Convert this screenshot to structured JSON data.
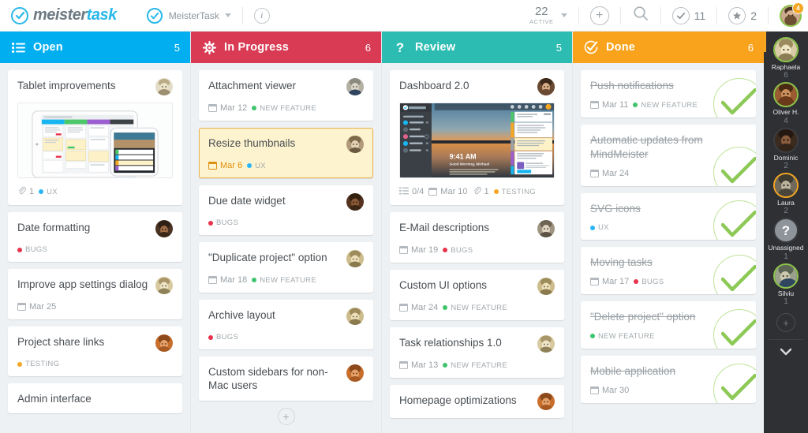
{
  "app": {
    "brand_meister": "meister",
    "brand_task": "task",
    "project_name": "MeisterTask",
    "info_icon": "info-icon",
    "logo_check_icon": "check-circle-icon",
    "project_check_icon": "check-circle-icon",
    "project_caret_icon": "chevron-down-icon"
  },
  "toolbar": {
    "active_count": "22",
    "active_label": "ACTIVE",
    "active_caret_icon": "chevron-down-icon",
    "add_icon": "plus-circle-icon",
    "search_icon": "search-icon",
    "tasks_icon": "check-circle-icon",
    "tasks_count": "11",
    "starred_icon": "star-circle-icon",
    "starred_count": "2",
    "avatar_icon": "user-avatar",
    "avatar_badge": "4",
    "colors": {
      "brand": "#2ab8e8",
      "badge": "#f5a623",
      "avatar_ring": "#8bc34a"
    }
  },
  "columns": [
    {
      "id": "open",
      "title": "Open",
      "count": "5",
      "color": "#01aff0",
      "icon": "list-icon",
      "cards": [
        {
          "title": "Tablet improvements",
          "avatar": "user-avatar",
          "image": "tablet-mockup-thumbnail",
          "meta": [
            {
              "type": "attachment",
              "icon": "paperclip-icon",
              "text": "1"
            },
            {
              "type": "tag",
              "text": "UX",
              "color": "#29b6f6"
            }
          ]
        },
        {
          "title": "Date formatting",
          "avatar": "user-avatar",
          "meta": [
            {
              "type": "tag",
              "text": "BUGS",
              "color": "#e8324b"
            }
          ]
        },
        {
          "title": "Improve app settings dialog",
          "avatar": "user-avatar",
          "meta": [
            {
              "type": "date",
              "icon": "calendar-icon",
              "text": "Mar 25"
            }
          ]
        },
        {
          "title": "Project share links",
          "avatar": "user-avatar",
          "meta": [
            {
              "type": "tag",
              "text": "TESTING",
              "color": "#f5a623"
            }
          ]
        },
        {
          "title": "Admin interface",
          "meta": []
        }
      ]
    },
    {
      "id": "in-progress",
      "title": "In Progress",
      "count": "6",
      "color": "#d93b54",
      "icon": "gear-icon",
      "cards": [
        {
          "title": "Attachment viewer",
          "avatar": "user-avatar",
          "meta": [
            {
              "type": "date",
              "icon": "calendar-icon",
              "text": "Mar 12"
            },
            {
              "type": "tag",
              "text": "NEW FEATURE",
              "color": "#3ec46d"
            }
          ]
        },
        {
          "title": "Resize thumbnails",
          "avatar": "user-avatar",
          "highlight": true,
          "meta": [
            {
              "type": "date",
              "icon": "calendar-icon",
              "text": "Mar 6"
            },
            {
              "type": "tag",
              "text": "UX",
              "color": "#29b6f6"
            }
          ]
        },
        {
          "title": "Due date widget",
          "avatar": "user-avatar",
          "meta": [
            {
              "type": "tag",
              "text": "BUGS",
              "color": "#e8324b"
            }
          ]
        },
        {
          "title": "\"Duplicate project\" option",
          "avatar": "user-avatar",
          "meta": [
            {
              "type": "date",
              "icon": "calendar-icon",
              "text": "Mar 18"
            },
            {
              "type": "tag",
              "text": "NEW FEATURE",
              "color": "#3ec46d"
            }
          ]
        },
        {
          "title": "Archive layout",
          "avatar": "user-avatar",
          "meta": [
            {
              "type": "tag",
              "text": "BUGS",
              "color": "#e8324b"
            }
          ]
        },
        {
          "title": "Custom sidebars for non-Mac users",
          "avatar": "user-avatar",
          "meta": []
        }
      ],
      "add_card_icon": "plus-icon"
    },
    {
      "id": "review",
      "title": "Review",
      "count": "5",
      "color": "#2cbcb2",
      "icon": "question-mark-icon",
      "cards": [
        {
          "title": "Dashboard 2.0",
          "avatar": "user-avatar",
          "image": "dashboard-screenshot-thumbnail",
          "meta": [
            {
              "type": "checklist",
              "icon": "checklist-icon",
              "text": "0/4"
            },
            {
              "type": "date",
              "icon": "calendar-icon",
              "text": "Mar 10"
            },
            {
              "type": "attachment",
              "icon": "paperclip-icon",
              "text": "1"
            },
            {
              "type": "tag",
              "text": "TESTING",
              "color": "#f5a623"
            }
          ]
        },
        {
          "title": "E-Mail descriptions",
          "avatar": "user-avatar",
          "meta": [
            {
              "type": "date",
              "icon": "calendar-icon",
              "text": "Mar 19"
            },
            {
              "type": "tag",
              "text": "BUGS",
              "color": "#e8324b"
            }
          ]
        },
        {
          "title": "Custom UI options",
          "avatar": "user-avatar",
          "meta": [
            {
              "type": "date",
              "icon": "calendar-icon",
              "text": "Mar 24"
            },
            {
              "type": "tag",
              "text": "NEW FEATURE",
              "color": "#3ec46d"
            }
          ]
        },
        {
          "title": "Task relationships 1.0",
          "avatar": "user-avatar",
          "meta": [
            {
              "type": "date",
              "icon": "calendar-icon",
              "text": "Mar 13"
            },
            {
              "type": "tag",
              "text": "NEW FEATURE",
              "color": "#3ec46d"
            }
          ]
        },
        {
          "title": "Homepage optimizations",
          "avatar": "user-avatar",
          "meta": []
        }
      ]
    },
    {
      "id": "done",
      "title": "Done",
      "count": "6",
      "color": "#f9a21b",
      "icon": "check-circle-icon",
      "done": true,
      "cards": [
        {
          "title": "Push notifications",
          "done": true,
          "check_icon": "check-icon",
          "meta": [
            {
              "type": "date",
              "icon": "calendar-icon",
              "text": "Mar 11"
            },
            {
              "type": "tag",
              "text": "NEW FEATURE",
              "color": "#3ec46d"
            }
          ]
        },
        {
          "title": "Automatic updates from MindMeister",
          "done": true,
          "check_icon": "check-icon",
          "meta": [
            {
              "type": "date",
              "icon": "calendar-icon",
              "text": "Mar 24"
            }
          ]
        },
        {
          "title": "SVG icons",
          "done": true,
          "check_icon": "check-icon",
          "meta": [
            {
              "type": "tag",
              "text": "UX",
              "color": "#29b6f6"
            }
          ]
        },
        {
          "title": "Moving tasks",
          "done": true,
          "check_icon": "check-icon",
          "meta": [
            {
              "type": "date",
              "icon": "calendar-icon",
              "text": "Mar 17"
            },
            {
              "type": "tag",
              "text": "BUGS",
              "color": "#e8324b"
            }
          ]
        },
        {
          "title": "\"Delete project\" option",
          "done": true,
          "check_icon": "check-icon",
          "meta": [
            {
              "type": "tag",
              "text": "NEW FEATURE",
              "color": "#3ec46d"
            }
          ]
        },
        {
          "title": "Mobile application",
          "done": true,
          "check_icon": "check-icon",
          "meta": [
            {
              "type": "date",
              "icon": "calendar-icon",
              "text": "Mar 30"
            }
          ]
        }
      ]
    }
  ],
  "sidebar": {
    "members": [
      {
        "name": "Raphaela",
        "count": "6",
        "ring": "#8bc34a",
        "avatar": "user-avatar",
        "skin": "#d9cba6",
        "hair": "#9b8a5c"
      },
      {
        "name": "Oliver H.",
        "count": "4",
        "ring": "#8bc34a",
        "avatar": "user-avatar",
        "skin": "#9a5c30",
        "hair": "#4a2a14"
      },
      {
        "name": "Dominic",
        "count": "2",
        "ring": "#3a3c40",
        "avatar": "user-avatar",
        "skin": "#6b4330",
        "hair": "#2e1c12"
      },
      {
        "name": "Laura",
        "count": "2",
        "ring": "#f5a623",
        "avatar": "user-avatar",
        "skin": "#8f8a7a",
        "hair": "#5b5248"
      },
      {
        "name": "Unassigned",
        "count": "1",
        "ring": "#3a3c40",
        "avatar": "question-mark-icon",
        "skin": "#8d949a",
        "hair": "#8d949a"
      },
      {
        "name": "Silviu",
        "count": "1",
        "ring": "#8bc34a",
        "avatar": "user-avatar",
        "skin": "#9aa08c",
        "hair": "#44504a"
      }
    ],
    "add_member_icon": "plus-icon",
    "collapse_icon": "chevron-down-icon"
  }
}
